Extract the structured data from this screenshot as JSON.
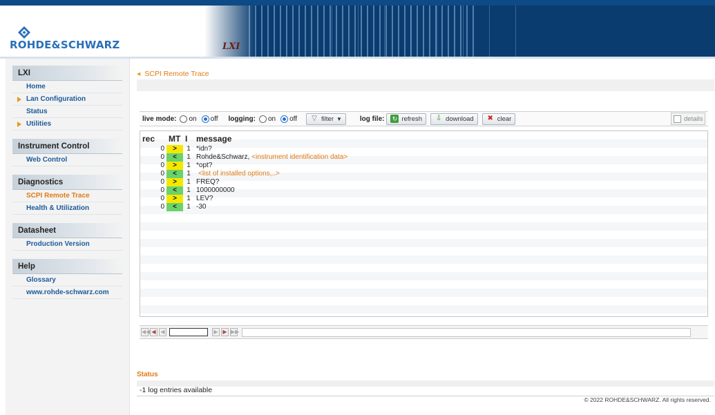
{
  "header": {
    "brand": "ROHDE&SCHWARZ",
    "lxi_logo": "LXI"
  },
  "sidebar": {
    "sections": [
      {
        "title": "LXI",
        "items": [
          {
            "label": "Home",
            "arrow": false,
            "active": false
          },
          {
            "label": "Lan Configuration",
            "arrow": true,
            "active": false
          },
          {
            "label": "Status",
            "arrow": false,
            "active": false
          },
          {
            "label": "Utilities",
            "arrow": true,
            "active": false
          }
        ]
      },
      {
        "title": "Instrument Control",
        "items": [
          {
            "label": "Web Control",
            "arrow": false,
            "active": false
          }
        ]
      },
      {
        "title": "Diagnostics",
        "items": [
          {
            "label": "SCPI Remote Trace",
            "arrow": false,
            "active": true
          },
          {
            "label": "Health & Utilization",
            "arrow": false,
            "active": false
          }
        ]
      },
      {
        "title": "Datasheet",
        "items": [
          {
            "label": "Production Version",
            "arrow": false,
            "active": false
          }
        ]
      },
      {
        "title": "Help",
        "items": [
          {
            "label": "Glossary",
            "arrow": false,
            "active": false
          },
          {
            "label": "www.rohde-schwarz.com",
            "arrow": false,
            "active": false
          }
        ]
      }
    ]
  },
  "breadcrumb": "SCPI Remote Trace",
  "toolbar": {
    "live_mode_label": "live mode:",
    "on_label": "on",
    "off_label": "off",
    "logging_label": "logging:",
    "filter_label": "filter",
    "log_file_label": "log file:",
    "refresh_label": "refresh",
    "download_label": "download",
    "clear_label": "clear",
    "details_label": "details",
    "live_mode": "off",
    "logging": "off"
  },
  "table": {
    "headers": {
      "rec": "rec",
      "mt": "MT",
      "i": "I",
      "message": "message"
    },
    "rows": [
      {
        "rec": "0",
        "mt": ">",
        "i": "1",
        "message": "*idn?",
        "extra": ""
      },
      {
        "rec": "0",
        "mt": "<",
        "i": "1",
        "message": "Rohde&Schwarz,",
        "extra": "<instrument identification data>"
      },
      {
        "rec": "0",
        "mt": ">",
        "i": "1",
        "message": "*opt?",
        "extra": ""
      },
      {
        "rec": "0",
        "mt": "<",
        "i": "1",
        "message": "",
        "extra": "<list of installed options,..>"
      },
      {
        "rec": "0",
        "mt": ">",
        "i": "1",
        "message": "FREQ?",
        "extra": ""
      },
      {
        "rec": "0",
        "mt": "<",
        "i": "1",
        "message": "1000000000",
        "extra": ""
      },
      {
        "rec": "0",
        "mt": ">",
        "i": "1",
        "message": "LEV?",
        "extra": ""
      },
      {
        "rec": "0",
        "mt": "<",
        "i": "1",
        "message": "-30",
        "extra": ""
      }
    ]
  },
  "status": {
    "title": "Status",
    "text": "-1 log entries available"
  },
  "footer": {
    "copyright": "© 2022 ROHDE&SCHWARZ. All rights reserved."
  },
  "colors": {
    "header_bg": "#0a3c70",
    "accent_orange": "#e07b16",
    "link_blue": "#1c5a99",
    "out_cell": "#f5e800",
    "in_cell": "#6bd26b"
  }
}
